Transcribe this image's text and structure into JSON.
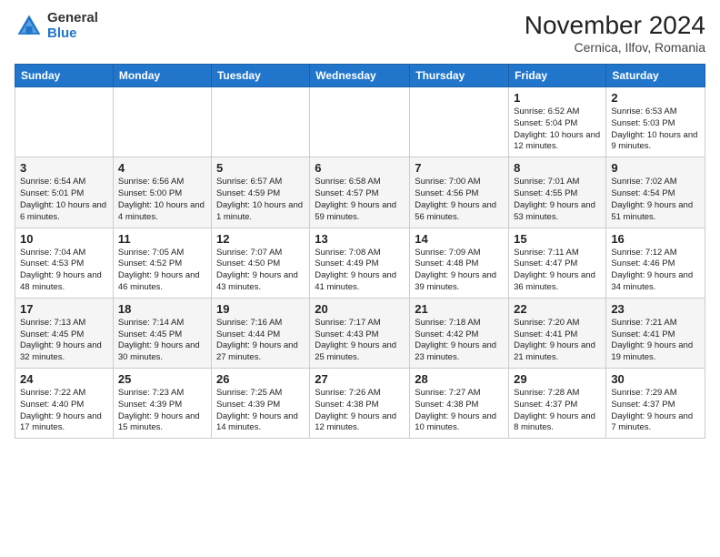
{
  "header": {
    "logo_general": "General",
    "logo_blue": "Blue",
    "month_title": "November 2024",
    "location": "Cernica, Ilfov, Romania"
  },
  "columns": [
    "Sunday",
    "Monday",
    "Tuesday",
    "Wednesday",
    "Thursday",
    "Friday",
    "Saturday"
  ],
  "weeks": [
    [
      {
        "day": "",
        "info": ""
      },
      {
        "day": "",
        "info": ""
      },
      {
        "day": "",
        "info": ""
      },
      {
        "day": "",
        "info": ""
      },
      {
        "day": "",
        "info": ""
      },
      {
        "day": "1",
        "info": "Sunrise: 6:52 AM\nSunset: 5:04 PM\nDaylight: 10 hours and 12 minutes."
      },
      {
        "day": "2",
        "info": "Sunrise: 6:53 AM\nSunset: 5:03 PM\nDaylight: 10 hours and 9 minutes."
      }
    ],
    [
      {
        "day": "3",
        "info": "Sunrise: 6:54 AM\nSunset: 5:01 PM\nDaylight: 10 hours and 6 minutes."
      },
      {
        "day": "4",
        "info": "Sunrise: 6:56 AM\nSunset: 5:00 PM\nDaylight: 10 hours and 4 minutes."
      },
      {
        "day": "5",
        "info": "Sunrise: 6:57 AM\nSunset: 4:59 PM\nDaylight: 10 hours and 1 minute."
      },
      {
        "day": "6",
        "info": "Sunrise: 6:58 AM\nSunset: 4:57 PM\nDaylight: 9 hours and 59 minutes."
      },
      {
        "day": "7",
        "info": "Sunrise: 7:00 AM\nSunset: 4:56 PM\nDaylight: 9 hours and 56 minutes."
      },
      {
        "day": "8",
        "info": "Sunrise: 7:01 AM\nSunset: 4:55 PM\nDaylight: 9 hours and 53 minutes."
      },
      {
        "day": "9",
        "info": "Sunrise: 7:02 AM\nSunset: 4:54 PM\nDaylight: 9 hours and 51 minutes."
      }
    ],
    [
      {
        "day": "10",
        "info": "Sunrise: 7:04 AM\nSunset: 4:53 PM\nDaylight: 9 hours and 48 minutes."
      },
      {
        "day": "11",
        "info": "Sunrise: 7:05 AM\nSunset: 4:52 PM\nDaylight: 9 hours and 46 minutes."
      },
      {
        "day": "12",
        "info": "Sunrise: 7:07 AM\nSunset: 4:50 PM\nDaylight: 9 hours and 43 minutes."
      },
      {
        "day": "13",
        "info": "Sunrise: 7:08 AM\nSunset: 4:49 PM\nDaylight: 9 hours and 41 minutes."
      },
      {
        "day": "14",
        "info": "Sunrise: 7:09 AM\nSunset: 4:48 PM\nDaylight: 9 hours and 39 minutes."
      },
      {
        "day": "15",
        "info": "Sunrise: 7:11 AM\nSunset: 4:47 PM\nDaylight: 9 hours and 36 minutes."
      },
      {
        "day": "16",
        "info": "Sunrise: 7:12 AM\nSunset: 4:46 PM\nDaylight: 9 hours and 34 minutes."
      }
    ],
    [
      {
        "day": "17",
        "info": "Sunrise: 7:13 AM\nSunset: 4:45 PM\nDaylight: 9 hours and 32 minutes."
      },
      {
        "day": "18",
        "info": "Sunrise: 7:14 AM\nSunset: 4:45 PM\nDaylight: 9 hours and 30 minutes."
      },
      {
        "day": "19",
        "info": "Sunrise: 7:16 AM\nSunset: 4:44 PM\nDaylight: 9 hours and 27 minutes."
      },
      {
        "day": "20",
        "info": "Sunrise: 7:17 AM\nSunset: 4:43 PM\nDaylight: 9 hours and 25 minutes."
      },
      {
        "day": "21",
        "info": "Sunrise: 7:18 AM\nSunset: 4:42 PM\nDaylight: 9 hours and 23 minutes."
      },
      {
        "day": "22",
        "info": "Sunrise: 7:20 AM\nSunset: 4:41 PM\nDaylight: 9 hours and 21 minutes."
      },
      {
        "day": "23",
        "info": "Sunrise: 7:21 AM\nSunset: 4:41 PM\nDaylight: 9 hours and 19 minutes."
      }
    ],
    [
      {
        "day": "24",
        "info": "Sunrise: 7:22 AM\nSunset: 4:40 PM\nDaylight: 9 hours and 17 minutes."
      },
      {
        "day": "25",
        "info": "Sunrise: 7:23 AM\nSunset: 4:39 PM\nDaylight: 9 hours and 15 minutes."
      },
      {
        "day": "26",
        "info": "Sunrise: 7:25 AM\nSunset: 4:39 PM\nDaylight: 9 hours and 14 minutes."
      },
      {
        "day": "27",
        "info": "Sunrise: 7:26 AM\nSunset: 4:38 PM\nDaylight: 9 hours and 12 minutes."
      },
      {
        "day": "28",
        "info": "Sunrise: 7:27 AM\nSunset: 4:38 PM\nDaylight: 9 hours and 10 minutes."
      },
      {
        "day": "29",
        "info": "Sunrise: 7:28 AM\nSunset: 4:37 PM\nDaylight: 9 hours and 8 minutes."
      },
      {
        "day": "30",
        "info": "Sunrise: 7:29 AM\nSunset: 4:37 PM\nDaylight: 9 hours and 7 minutes."
      }
    ]
  ]
}
